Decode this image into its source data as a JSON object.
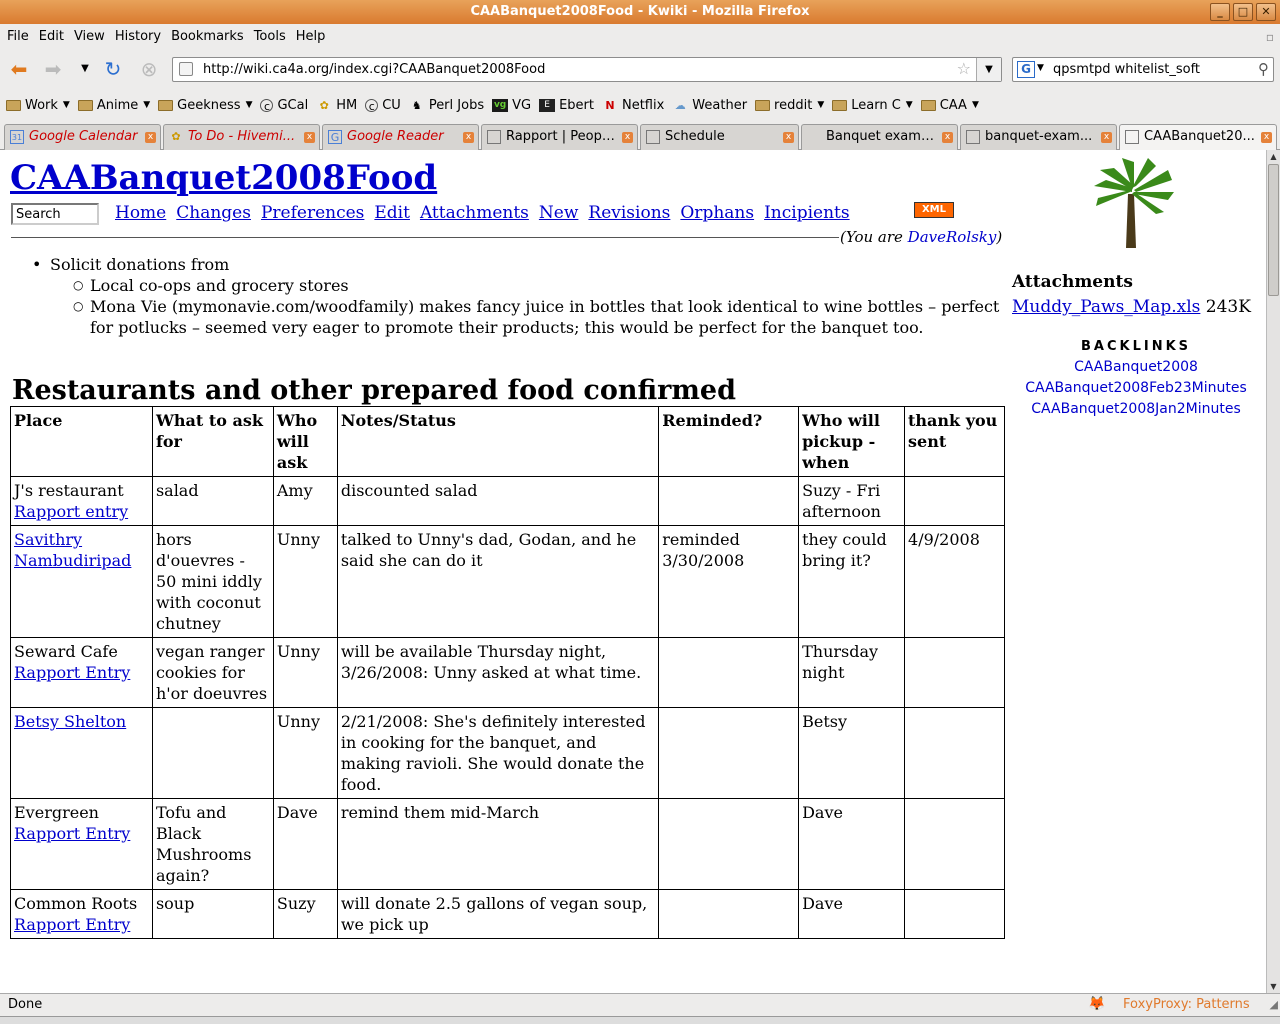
{
  "window": {
    "title": "CAABanquet2008Food - Kwiki - Mozilla Firefox",
    "buttons": [
      "_",
      "□",
      "✕"
    ]
  },
  "menu": [
    "File",
    "Edit",
    "View",
    "History",
    "Bookmarks",
    "Tools",
    "Help"
  ],
  "nav": {
    "url": "http://wiki.ca4a.org/index.cgi?CAABanquet2008Food",
    "search_value": "qpsmtpd whitelist_soft",
    "search_engine_letter": "G"
  },
  "bookmarks": [
    {
      "label": "Work",
      "icon": "folder-icon",
      "menu": true
    },
    {
      "label": "Anime",
      "icon": "folder-icon",
      "menu": true
    },
    {
      "label": "Geekness",
      "icon": "folder-icon",
      "menu": true
    },
    {
      "label": "GCal",
      "icon": "cu-icon",
      "menu": false
    },
    {
      "label": "HM",
      "icon": "bee-icon",
      "menu": false
    },
    {
      "label": "CU",
      "icon": "cu-icon",
      "menu": false
    },
    {
      "label": "Perl Jobs",
      "icon": "camel-icon",
      "menu": false
    },
    {
      "label": "VG",
      "icon": "vg-icon",
      "menu": false
    },
    {
      "label": "Ebert",
      "icon": "ebert-icon",
      "menu": false
    },
    {
      "label": "Netflix",
      "icon": "netflix-icon",
      "menu": false
    },
    {
      "label": "Weather",
      "icon": "weather-icon",
      "menu": false
    },
    {
      "label": "reddit",
      "icon": "folder-icon",
      "menu": true
    },
    {
      "label": "Learn C",
      "icon": "folder-icon",
      "menu": true
    },
    {
      "label": "CAA",
      "icon": "folder-icon",
      "menu": true
    }
  ],
  "tabs": [
    {
      "label": "Google Calendar",
      "red": true,
      "active": false
    },
    {
      "label": "To Do - Hivemi...",
      "red": true,
      "active": false
    },
    {
      "label": "Google Reader",
      "red": true,
      "active": false
    },
    {
      "label": "Rapport | Peopl...",
      "red": false,
      "active": false
    },
    {
      "label": "Schedule",
      "red": false,
      "active": false
    },
    {
      "label": "Banquet example",
      "red": false,
      "active": false
    },
    {
      "label": "banquet-exam...",
      "red": false,
      "active": false
    },
    {
      "label": "CAABanquet20...",
      "red": false,
      "active": true
    }
  ],
  "page": {
    "title": "CAABanquet2008Food",
    "search_value": "Search",
    "wiki_nav": [
      "Home",
      "Changes",
      "Preferences",
      "Edit",
      "Attachments",
      "New",
      "Revisions",
      "Orphans",
      "Incipients"
    ],
    "xml_badge": "XML",
    "you_are_prefix": "(You are ",
    "you_are_user": "DaveRolsky",
    "you_are_suffix": ")",
    "bullet_main": "Solicit donations from",
    "bullet_sub_1": "Local co-ops and grocery stores",
    "bullet_sub_2": "Mona Vie (mymonavie.com/woodfamily) makes fancy juice in bottles that look identical to wine bottles – perfect for potlucks – seemed very eager to promote their products; this would be perfect for the banquet too.",
    "section_heading": "Restaurants and other prepared food confirmed",
    "table_headers": [
      "Place",
      "What to ask for",
      "Who will ask",
      "Notes/Status",
      "Reminded?",
      "Who will pickup - when",
      "thank you sent"
    ],
    "rows": [
      {
        "place": "J's restaurant",
        "place_link": "Rapport entry",
        "place_is_link": false,
        "what": "salad",
        "who": "Amy",
        "notes": "discounted salad",
        "reminded": "",
        "pickup": "Suzy - Fri afternoon",
        "thanks": ""
      },
      {
        "place": "Savithry Nambudiripad",
        "place_link": "",
        "place_is_link": true,
        "what": "hors d'ouevres - 50 mini iddly with coconut chutney",
        "who": "Unny",
        "notes": "talked to Unny's dad, Godan, and he said she can do it",
        "reminded": "reminded 3/30/2008",
        "pickup": "they could bring it?",
        "thanks": "4/9/2008"
      },
      {
        "place": "Seward Cafe",
        "place_link": "Rapport Entry",
        "place_is_link": false,
        "what": "vegan ranger cookies for h'or doeuvres",
        "who": "Unny",
        "notes": "will be available Thursday night, 3/26/2008: Unny asked at what time.",
        "reminded": "",
        "pickup": "Thursday night",
        "thanks": ""
      },
      {
        "place": "Betsy Shelton",
        "place_link": "",
        "place_is_link": true,
        "what": "",
        "who": "Unny",
        "notes": "2/21/2008: She's definitely interested in cooking for the banquet, and making ravioli. She would donate the food.",
        "reminded": "",
        "pickup": "Betsy",
        "thanks": ""
      },
      {
        "place": "Evergreen",
        "place_link": "Rapport Entry",
        "place_is_link": false,
        "what": "Tofu and Black Mushrooms again?",
        "who": "Dave",
        "notes": "remind them mid-March",
        "reminded": "",
        "pickup": "Dave",
        "thanks": ""
      },
      {
        "place": "Common Roots",
        "place_link": "Rapport Entry",
        "place_is_link": false,
        "what": "soup",
        "who": "Suzy",
        "notes": "will donate 2.5 gallons of vegan soup, we pick up",
        "reminded": "",
        "pickup": "Dave",
        "thanks": ""
      }
    ]
  },
  "sidebar": {
    "attachments_heading": "Attachments",
    "attachment_name": "Muddy_Paws_Map.xls",
    "attachment_size": "243K",
    "backlinks_heading": "BACKLINKS",
    "backlinks": [
      "CAABanquet2008",
      "CAABanquet2008Feb23Minutes",
      "CAABanquet2008Jan2Minutes"
    ]
  },
  "status": {
    "text": "Done",
    "foxyproxy": "FoxyProxy: Patterns"
  },
  "colors": {
    "titlebar": "#d97a2f",
    "link": "#0000cc",
    "tab_close": "#e5823a",
    "xml_badge": "#ff6600"
  }
}
